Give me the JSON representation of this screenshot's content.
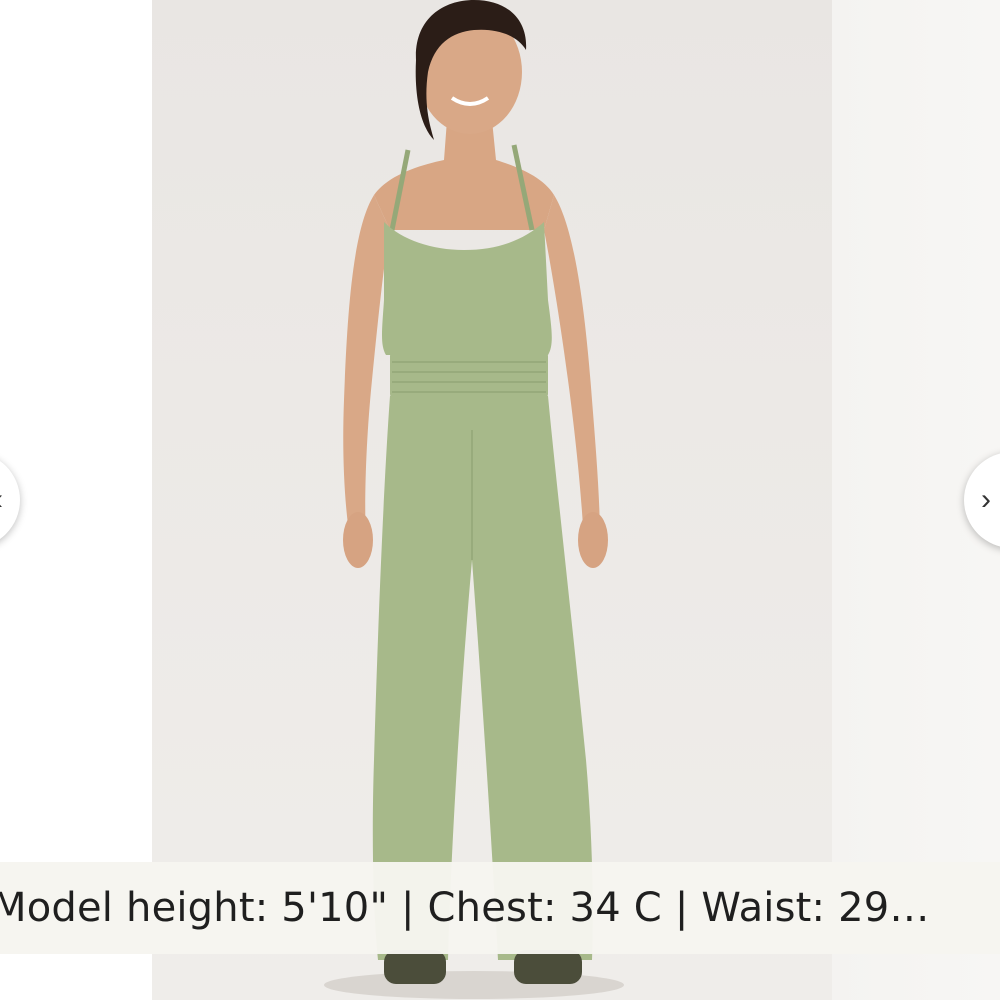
{
  "gallery": {
    "image_alt": "",
    "prev_icon": "chevron-left-icon",
    "next_icon": "chevron-right-icon",
    "prev_glyph": "‹",
    "next_glyph": "›",
    "garment_color": "#a7b98a",
    "background_color": "#ebe8e5"
  },
  "caption": {
    "text": "Model height: 5'10\" | Chest: 34 C | Waist: 29…"
  }
}
